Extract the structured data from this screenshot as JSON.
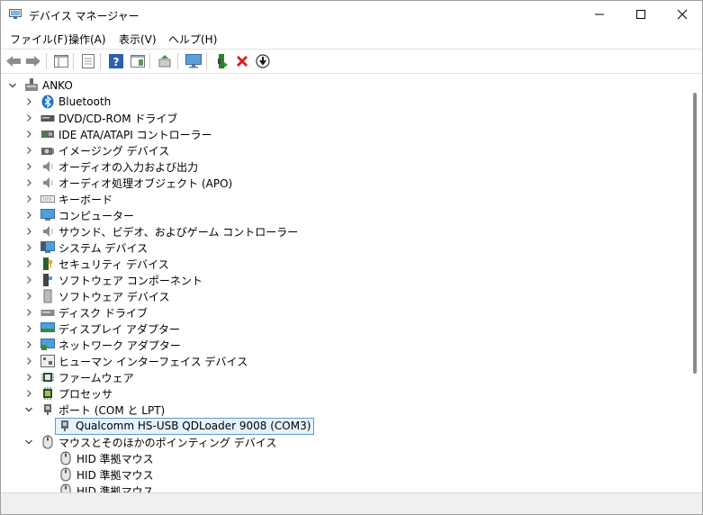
{
  "window": {
    "title": "デバイス マネージャー"
  },
  "menu": {
    "file": "ファイル(F)",
    "action": "操作(A)",
    "view": "表示(V)",
    "help": "ヘルプ(H)"
  },
  "tree": {
    "root": "ANKO",
    "categories": [
      "Bluetooth",
      "DVD/CD-ROM ドライブ",
      "IDE ATA/ATAPI コントローラー",
      "イメージング デバイス",
      "オーディオの入力および出力",
      "オーディオ処理オブジェクト (APO)",
      "キーボード",
      "コンピューター",
      "サウンド、ビデオ、およびゲーム コントローラー",
      "システム デバイス",
      "セキュリティ デバイス",
      "ソフトウェア コンポーネント",
      "ソフトウェア デバイス",
      "ディスク ドライブ",
      "ディスプレイ アダプター",
      "ネットワーク アダプター",
      "ヒューマン インターフェイス デバイス",
      "ファームウェア",
      "プロセッサ"
    ],
    "ports": {
      "label": "ポート (COM と LPT)",
      "children": [
        "Qualcomm HS-USB QDLoader 9008 (COM3)"
      ]
    },
    "mouse": {
      "label": "マウスとそのほかのポインティング デバイス",
      "children": [
        "HID 準拠マウス",
        "HID 準拠マウス",
        "HID 準拠マウス"
      ]
    }
  },
  "colors": {
    "selection_border": "#5b9bd5",
    "selection_bg": "#e5f1fb"
  }
}
